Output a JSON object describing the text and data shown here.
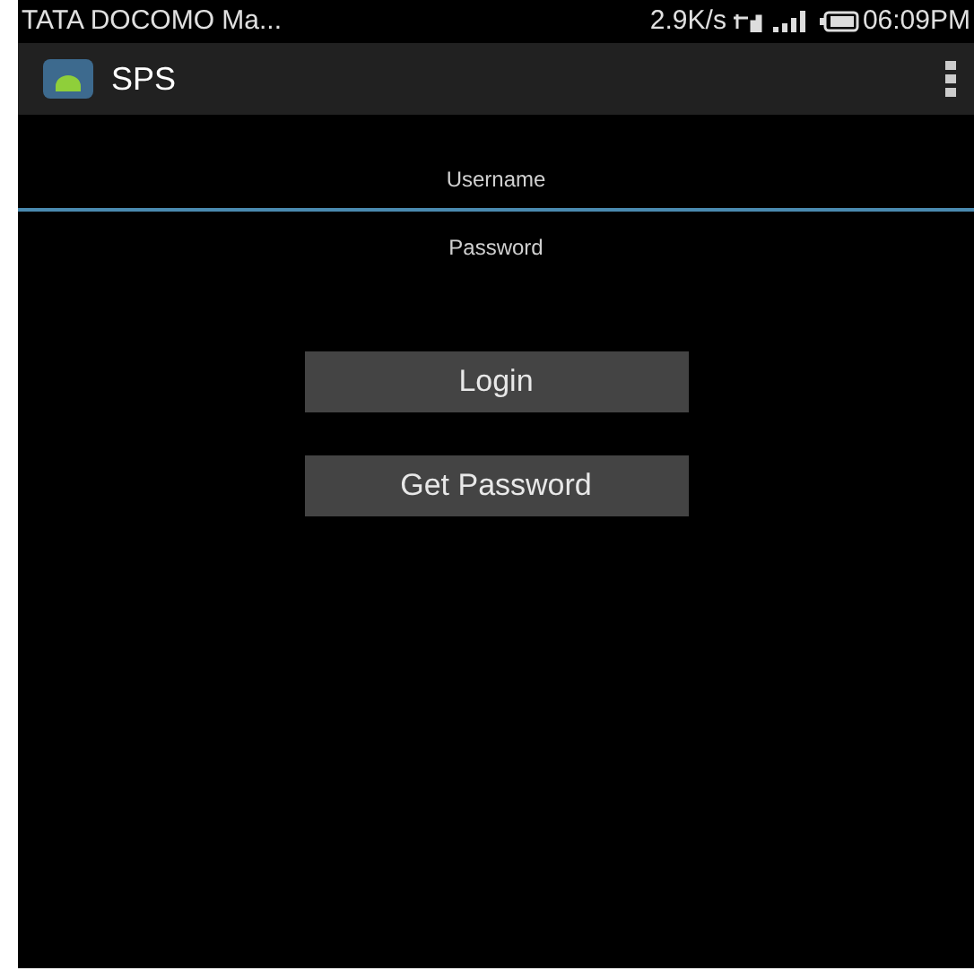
{
  "status_bar": {
    "carrier": "TATA DOCOMO Ma...",
    "speed": "2.9K/s",
    "time": "06:09PM"
  },
  "action_bar": {
    "title": "SPS"
  },
  "fields": [
    {
      "placeholder": "Username",
      "focused": true
    },
    {
      "placeholder": "Password",
      "focused": false
    }
  ],
  "buttons": [
    "Login",
    "Get Password"
  ]
}
